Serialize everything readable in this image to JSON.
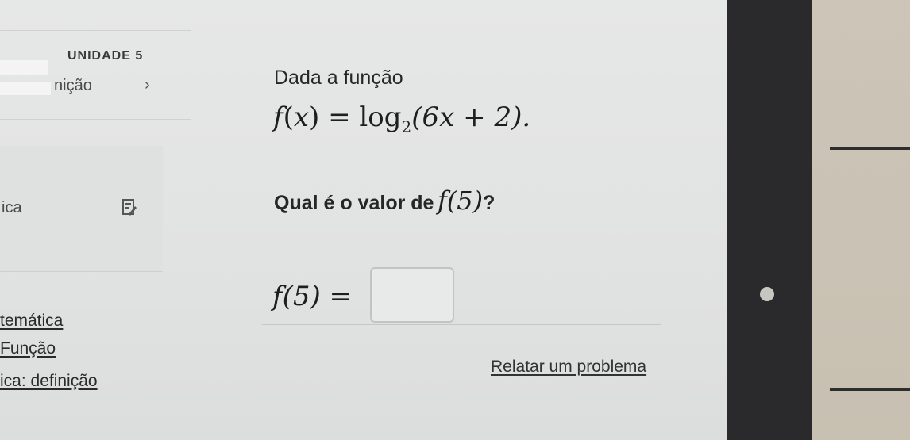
{
  "sidebar": {
    "unit_label": "UNIDADE 5",
    "items": [
      {
        "label": "nição"
      },
      {
        "label": "ica"
      }
    ],
    "links": [
      {
        "label": "temática"
      },
      {
        "label": "Função"
      },
      {
        "label": "ica: definição"
      }
    ]
  },
  "main": {
    "prompt": "Dada a função",
    "function_def": {
      "name": "f",
      "var": "x",
      "log": "log",
      "base": "2",
      "argument": "(6x + 2)."
    },
    "question_prefix": "Qual é o valor de",
    "question_expr": "f(5)",
    "question_suffix": "?",
    "answer_label": "f(5) =",
    "answer_value": "",
    "report_link": "Relatar um problema"
  }
}
